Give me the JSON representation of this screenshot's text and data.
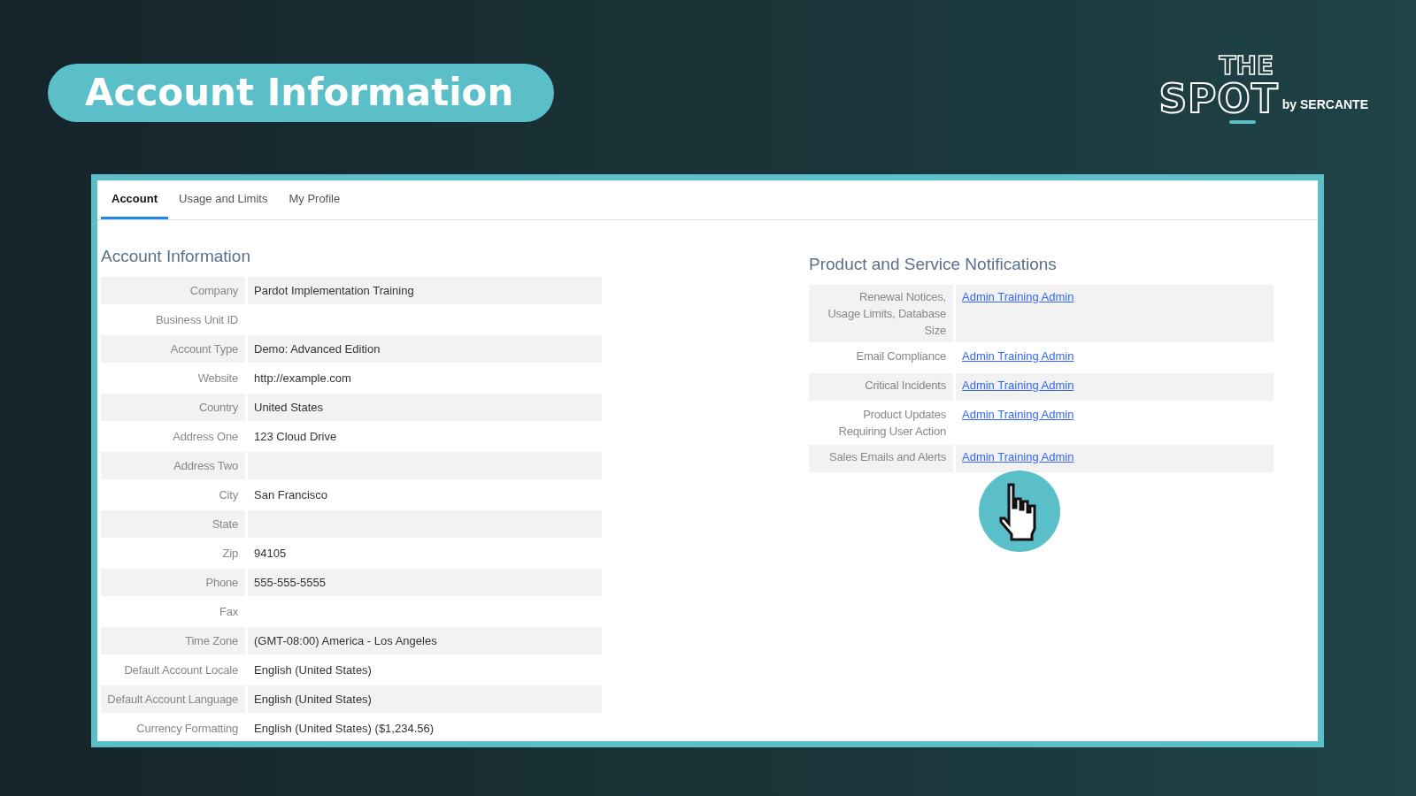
{
  "slide_title": "Account Information",
  "logo": {
    "line_1": "THE",
    "line_2": "SPOT",
    "byline": "by SERCANTE"
  },
  "tabs": [
    {
      "label": "Account",
      "selected": true
    },
    {
      "label": "Usage and Limits",
      "selected": false
    },
    {
      "label": "My Profile",
      "selected": false
    }
  ],
  "account_section": {
    "heading": "Account Information",
    "rows": [
      {
        "label": "Company",
        "value": "Pardot Implementation Training"
      },
      {
        "label": "Business Unit ID"
      },
      {
        "label": "Account Type",
        "value": "Demo: Advanced Edition"
      },
      {
        "label": "Website",
        "value": "http://example.com"
      },
      {
        "label": "Country",
        "value": "United States"
      },
      {
        "label": "Address One",
        "value": "123 Cloud Drive"
      },
      {
        "label": "Address Two"
      },
      {
        "label": "City",
        "value": "San Francisco"
      },
      {
        "label": "State"
      },
      {
        "label": "Zip",
        "value": "94105"
      },
      {
        "label": "Phone",
        "value": "555-555-5555"
      },
      {
        "label": "Fax"
      },
      {
        "label": "Time Zone",
        "value": "(GMT-08:00) America - Los Angeles"
      },
      {
        "label": "Default Account Locale",
        "value": "English (United States)"
      },
      {
        "label": "Default Account Language",
        "value": "English (United States)"
      },
      {
        "label": "Currency Formatting",
        "value": "English (United States) ($1,234.56)"
      }
    ]
  },
  "notifications_section": {
    "heading": "Product and Service Notifications",
    "rows": [
      {
        "label": "Renewal Notices, Usage Limits, Database Size",
        "link": "Admin Training Admin"
      },
      {
        "label": "Email Compliance",
        "link": "Admin Training Admin"
      },
      {
        "label": "Critical Incidents",
        "link": "Admin Training Admin"
      },
      {
        "label": "Product Updates Requiring User Action",
        "link": "Admin Training Admin"
      },
      {
        "label": "Sales Emails and Alerts",
        "link": "Admin Training Admin"
      }
    ]
  }
}
